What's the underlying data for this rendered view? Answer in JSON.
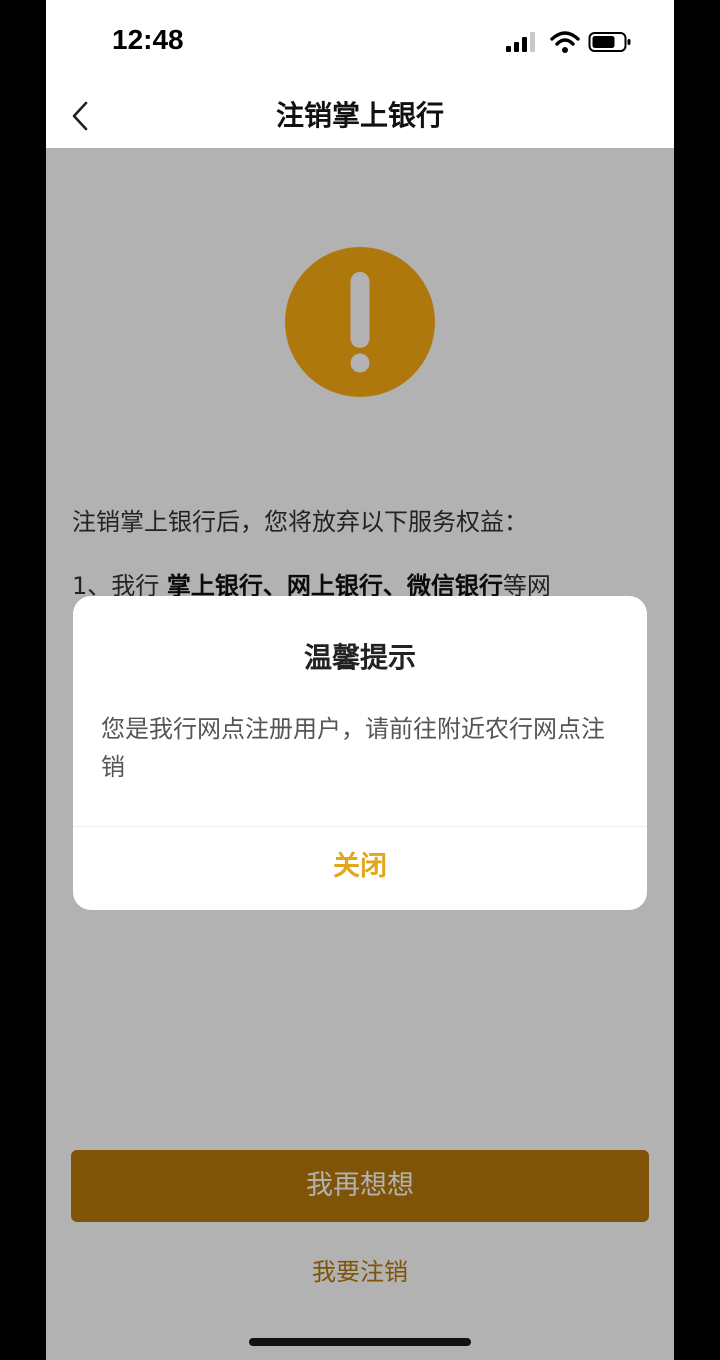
{
  "status_bar": {
    "time": "12:48"
  },
  "nav": {
    "title": "注销掌上银行"
  },
  "content": {
    "intro": "注销掌上银行后，您将放弃以下服务权益：",
    "item_prefix": "1、我行 ",
    "item_bold": "掌上银行、网上银行、微信银行",
    "item_suffix": "等网",
    "primary_button": "我再想想",
    "secondary_link": "我要注销"
  },
  "dialog": {
    "title": "温馨提示",
    "message": "您是我行网点注册用户，请前往附近农行网点注销",
    "close_label": "关闭"
  },
  "colors": {
    "accent": "#b7790a",
    "dialog_action": "#e3a51a"
  }
}
